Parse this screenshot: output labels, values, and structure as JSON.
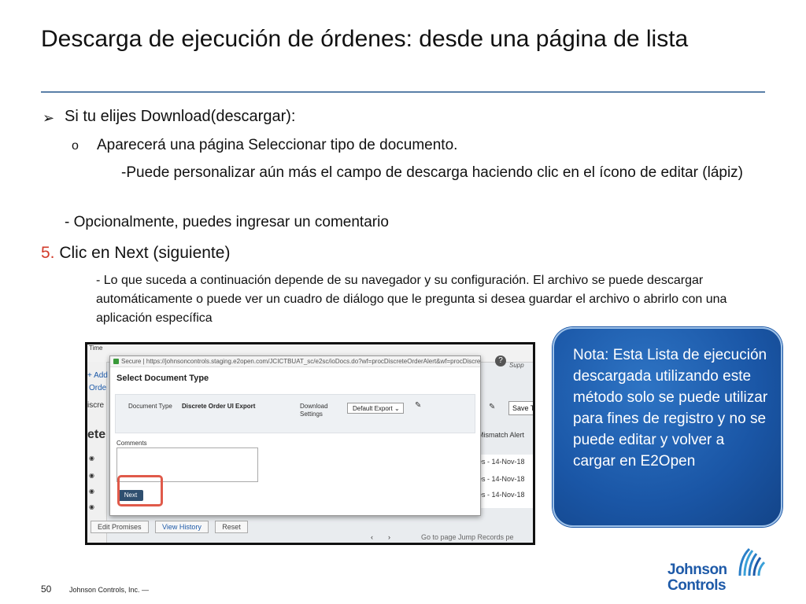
{
  "slide": {
    "title": "Descarga de ejecución de órdenes: desde una página de lista",
    "bullets": {
      "b1_mark": "➢",
      "b1": "Si tu elijes Download(descargar):",
      "b2_mark": "o",
      "b2": "Aparecerá una página Seleccionar tipo de documento.",
      "b3": "-Puede personalizar aún más el campo de descarga haciendo clic en el ícono de editar (lápiz)",
      "b4": "- Opcionalmente, puedes ingresar un comentario",
      "b5_num": "5.",
      "b5": " Clic en Next (siguiente)",
      "b6": "- Lo que suceda a continuación depende de su navegador y su configuración. El archivo se puede descargar automáticamente o puede ver un cuadro de diálogo que le pregunta si desea guardar el archivo o abrirlo con una aplicación específica"
    },
    "note": "Nota: Esta Lista de ejecución descargada utilizando este método solo se puede utilizar para fines de registro y no se puede editar y volver a cargar en E2Open",
    "page_number": "50",
    "footer": "Johnson Controls, Inc. —",
    "logo_line1": "Johnson",
    "logo_line2": "Controls",
    "colors": {
      "accent_red": "#d23b2a",
      "note_blue": "#1a56a6",
      "rule": "#5a7fa8"
    }
  },
  "screenshot": {
    "background": {
      "tab_fragment": "Time",
      "left_fragments": [
        "+ Add",
        "Orde",
        "iscre",
        "ete"
      ],
      "supp": "Supp",
      "save_label": "Save T",
      "mismatch": "Mismatch Alert",
      "rows": [
        "es - 14-Nov-18",
        "es - 14-Nov-18",
        "es - 14-Nov-18"
      ],
      "buttons": [
        "Edit Promises",
        "View History",
        "Reset"
      ],
      "pager": "Go to page   Jump   Records pe"
    },
    "dialog": {
      "secure_label": "Secure",
      "url": "https://johnsoncontrols.staging.e2open.com/JCICTBUAT_sc/e2sc/ioDocs.do?wf=procDiscreteOrderAlert&wf=procDiscrete...",
      "title": "Select Document Type",
      "document_type_label": "Document Type",
      "document_type_value": "Discrete Order UI Export",
      "download_settings_label": "Download Settings",
      "download_settings_value": "Default Export",
      "comments_label": "Comments",
      "next_label": "Next"
    }
  }
}
